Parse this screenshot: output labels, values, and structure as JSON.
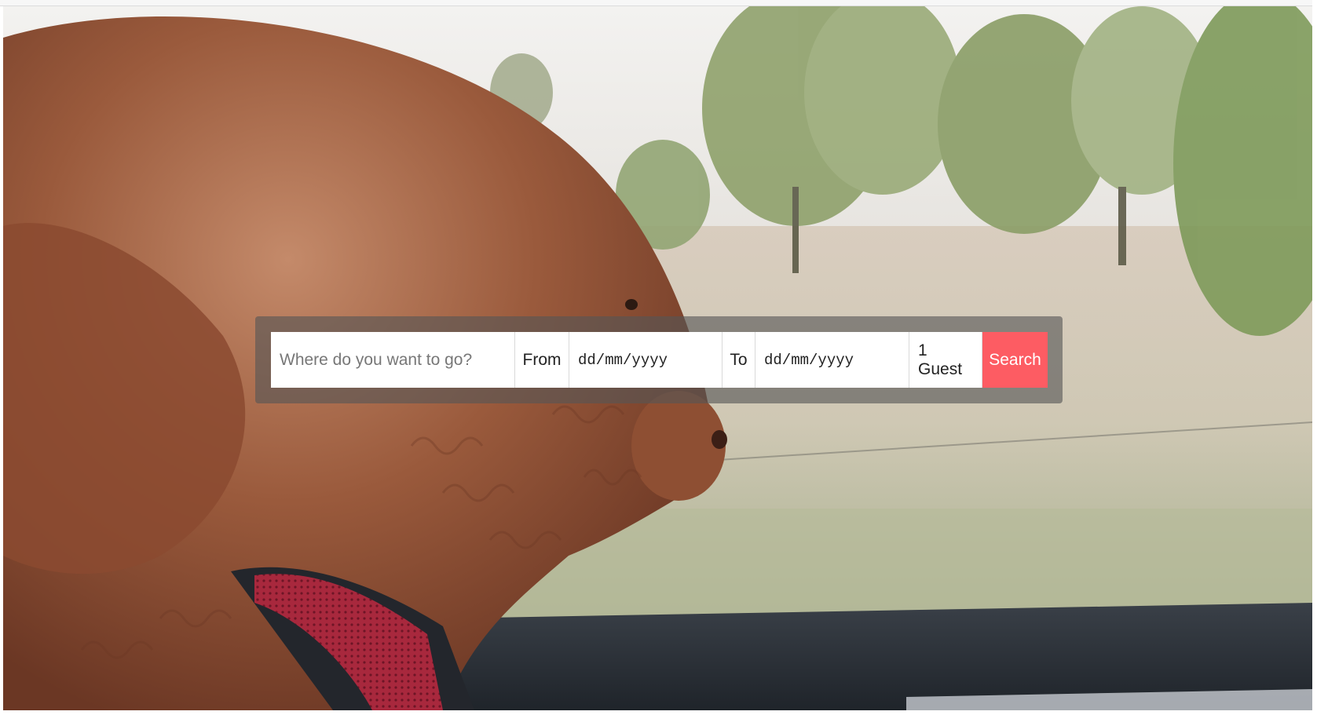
{
  "hero": {
    "image_description": "dog-in-car-window-video",
    "colors": {
      "fur": "#8a4d32",
      "collar": "#a8283d",
      "car_door": "#2a2f36",
      "foliage": "#8fa16b",
      "sky": "#f2f1ef"
    }
  },
  "search": {
    "destination_placeholder": "Where do you want to go?",
    "from_label": "From",
    "from_date": "dd/mm/yyyy",
    "to_label": "To",
    "to_date": "dd/mm/yyyy",
    "guests": "1 Guest",
    "button_label": "Search",
    "button_color": "#fd5c63"
  }
}
